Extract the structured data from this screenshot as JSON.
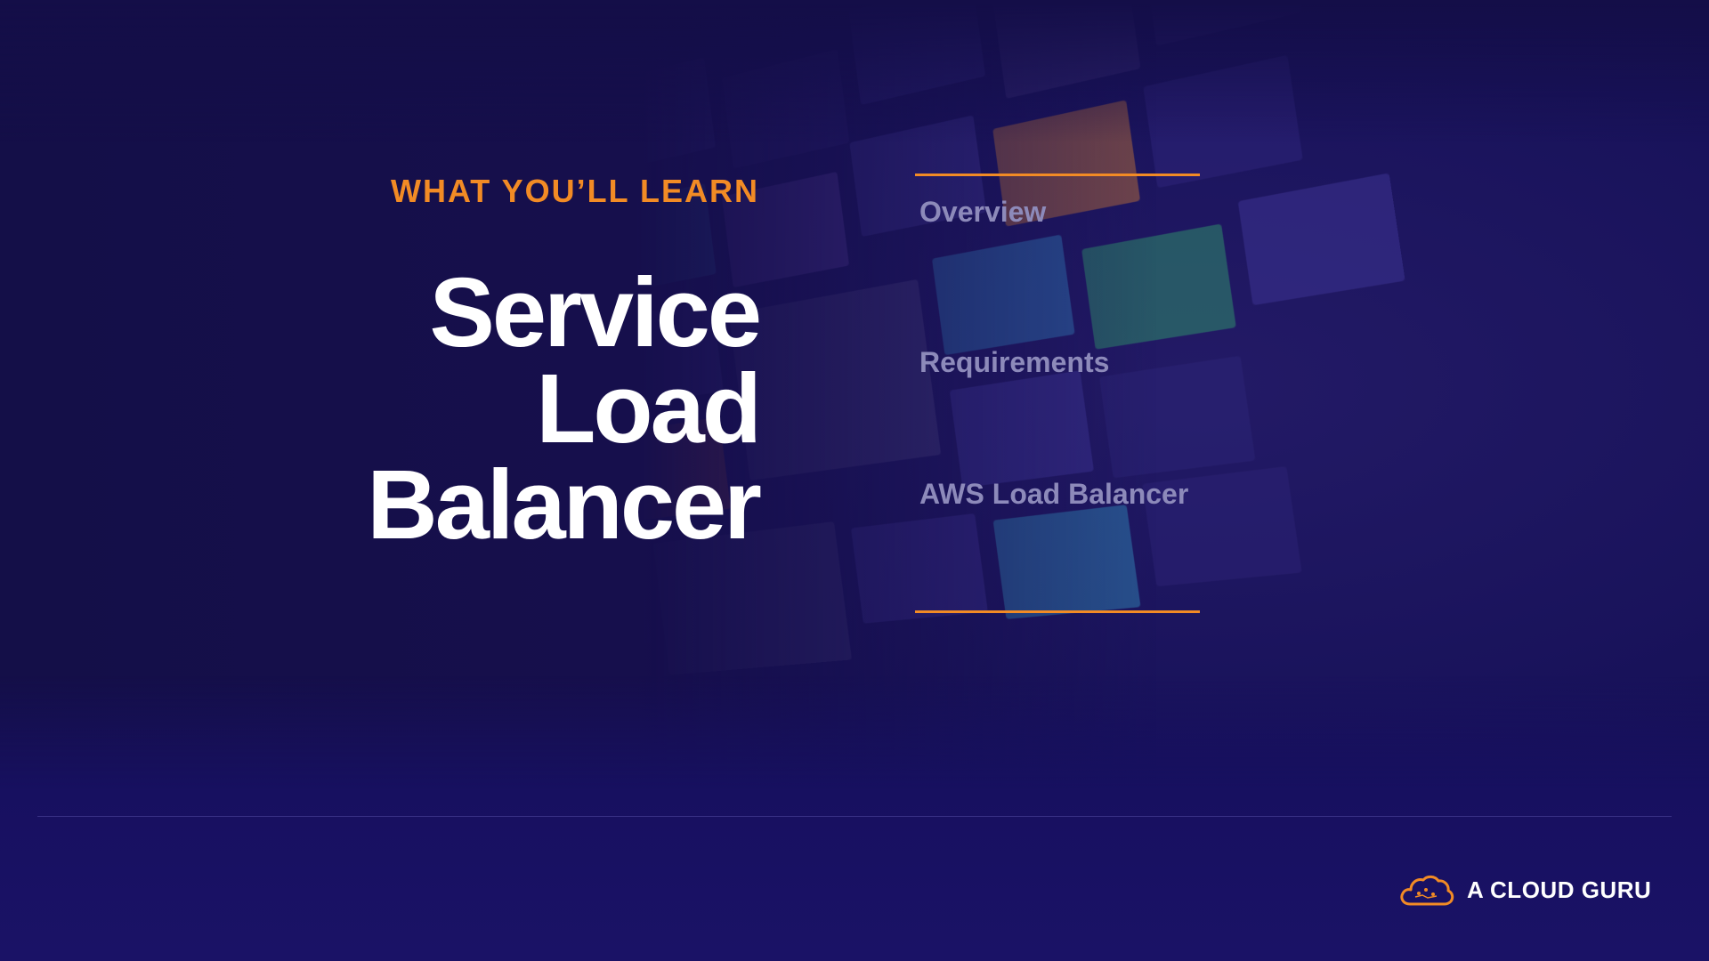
{
  "slide": {
    "eyebrow": "WHAT YOU’LL LEARN",
    "title_lines": [
      "Service",
      "Load",
      "Balancer"
    ],
    "agenda": [
      "Overview",
      "Requirements",
      "AWS Load Balancer"
    ]
  },
  "brand": {
    "name": "A CLOUD GURU",
    "icon": "cloud-logo-icon"
  },
  "colors": {
    "background": "#18125a",
    "accent": "#f28b25",
    "title": "#ffffff",
    "agenda_text": "#8d8aba"
  }
}
